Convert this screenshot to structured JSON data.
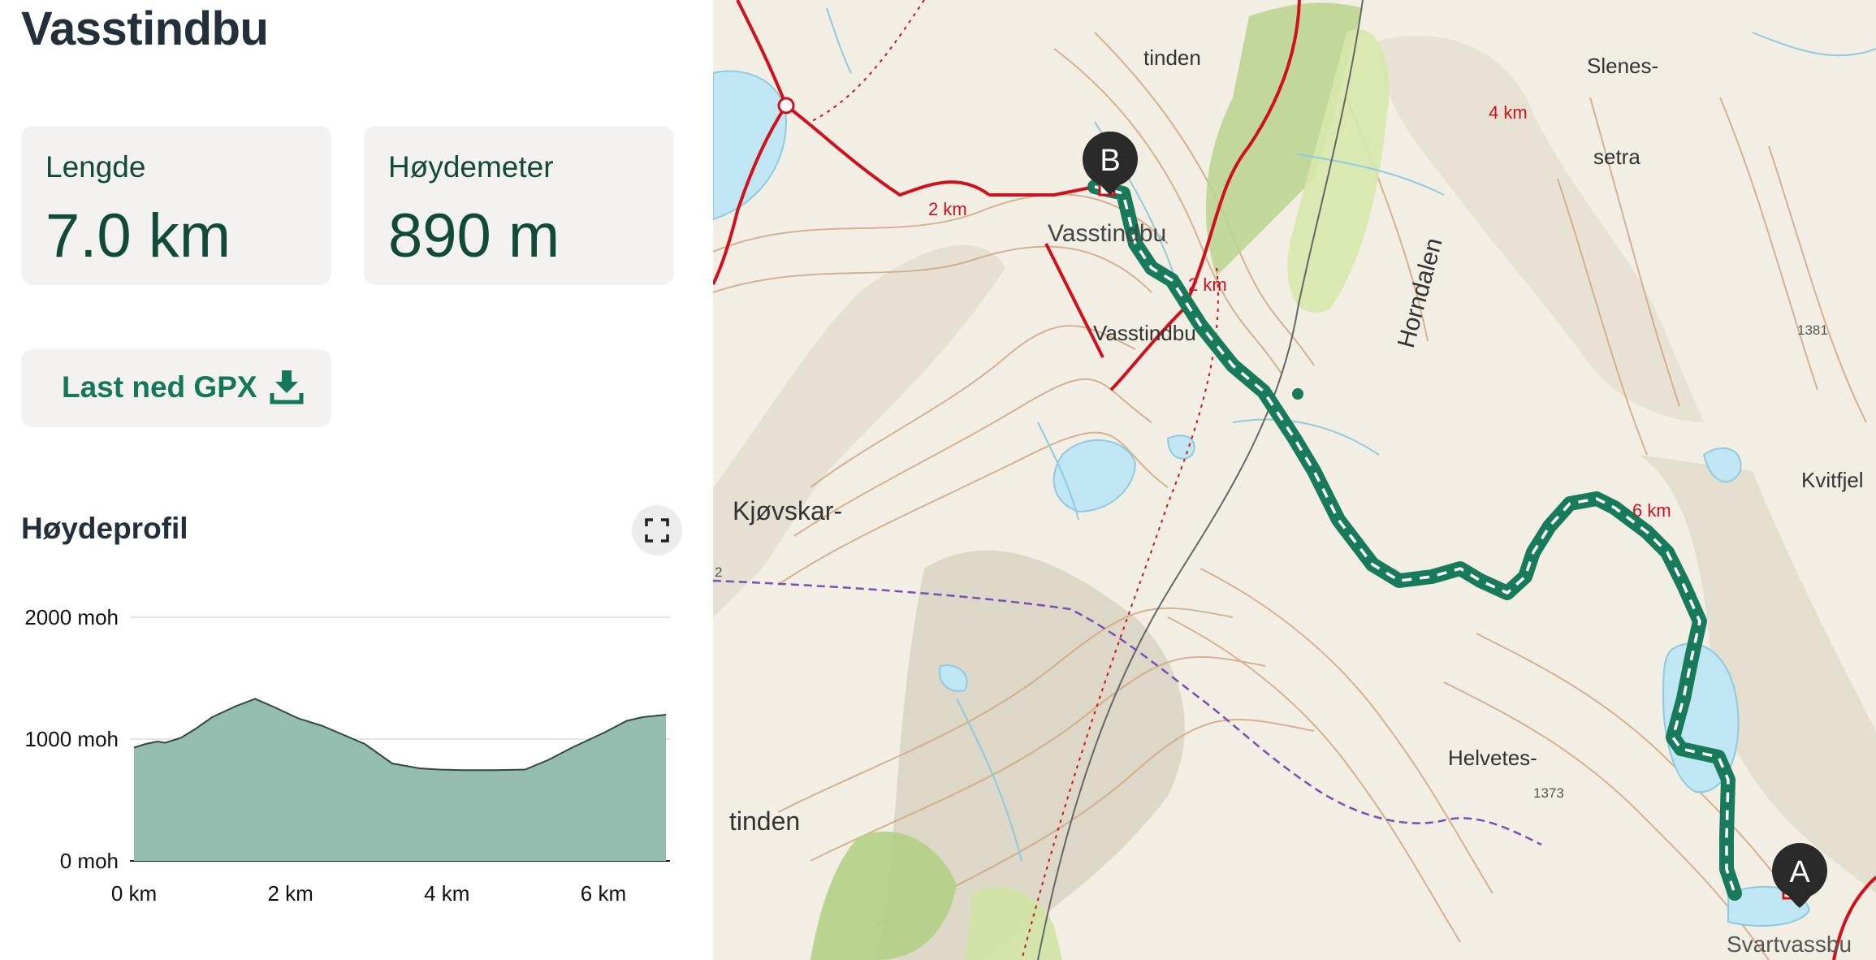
{
  "title": "Vasstindbu",
  "stats": [
    {
      "label": "Lengde",
      "value": "7.0 km"
    },
    {
      "label": "Høydemeter",
      "value": "890 m"
    }
  ],
  "download": {
    "label": "Last ned GPX",
    "icon": "download-icon"
  },
  "elevation": {
    "section_title": "Høydeprofil",
    "expand_icon": "fullscreen-icon",
    "fill_color": "#94bdb0",
    "line_color": "#2f4a40"
  },
  "chart_data": {
    "type": "area",
    "title": "",
    "xlabel": "",
    "ylabel": "",
    "xlim": [
      0,
      6.8
    ],
    "ylim": [
      0,
      2000
    ],
    "grid": true,
    "x_ticks": [
      "0 km",
      "2 km",
      "4 km",
      "6 km"
    ],
    "x_tick_values": [
      0,
      2,
      4,
      6
    ],
    "y_ticks": [
      "0 moh",
      "1000 moh",
      "2000 moh"
    ],
    "y_tick_values": [
      0,
      1000,
      2000
    ],
    "series": [
      {
        "x": [
          0,
          0.15,
          0.3,
          0.4,
          0.6,
          0.8,
          1.0,
          1.3,
          1.55,
          1.8,
          2.1,
          2.4,
          2.95,
          3.3,
          3.65,
          3.9,
          4.2,
          4.6,
          5.0,
          5.3,
          5.6,
          6.0,
          6.3,
          6.5,
          6.8
        ],
        "y": [
          930,
          960,
          980,
          970,
          1010,
          1090,
          1180,
          1270,
          1330,
          1260,
          1170,
          1110,
          960,
          800,
          760,
          750,
          745,
          745,
          750,
          830,
          930,
          1050,
          1150,
          1180,
          1200
        ]
      }
    ]
  },
  "map": {
    "place_labels": [
      "tinden",
      "Slenes-",
      "setra",
      "Vasstindbu",
      "Vasstindbu",
      "Horndalen",
      "Kjøvskar-",
      "Kvitfjel",
      "Helvetes-",
      "tinden",
      "Svartvassbu"
    ],
    "distance_labels": [
      "4 km",
      "2 km",
      "2 km",
      "6 km"
    ],
    "spot_heights": [
      "1381",
      "1373",
      "2"
    ],
    "markers": [
      {
        "letter": "B",
        "name": "end-marker"
      },
      {
        "letter": "A",
        "name": "start-marker"
      }
    ],
    "route_color": "#177a5a",
    "trail_color": "#d0111c",
    "border_color": "#7a4fb5"
  }
}
